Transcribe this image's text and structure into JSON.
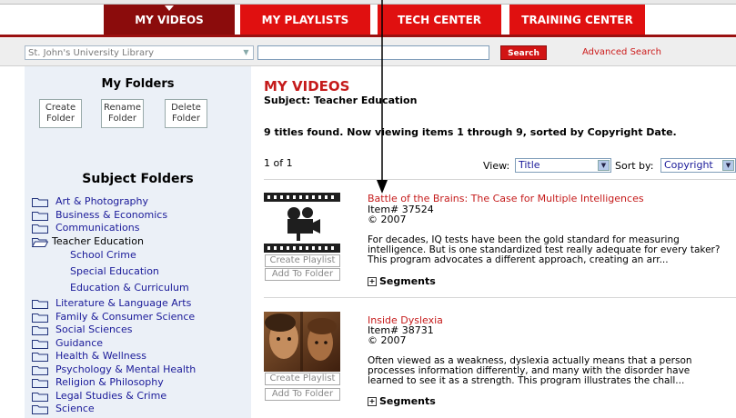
{
  "nav": {
    "tabs": [
      {
        "label": "MY VIDEOS"
      },
      {
        "label": "MY PLAYLISTS"
      },
      {
        "label": "TECH CENTER"
      },
      {
        "label": "TRAINING CENTER"
      }
    ]
  },
  "search": {
    "library_value": "St. John's University Library",
    "query_value": "",
    "button_label": "Search",
    "advanced_label": "Advanced Search"
  },
  "sidebar": {
    "my_folders_title": "My Folders",
    "folder_buttons": [
      {
        "line1": "Create",
        "line2": "Folder"
      },
      {
        "line1": "Rename",
        "line2": "Folder"
      },
      {
        "line1": "Delete",
        "line2": "Folder"
      }
    ],
    "subject_folders_title": "Subject Folders",
    "folders": [
      "Art & Photography",
      "Business & Economics",
      "Communications",
      "Teacher Education",
      "Literature & Language Arts",
      "Family & Consumer Science",
      "Social Sciences",
      "Guidance",
      "Health & Wellness",
      "Psychology & Mental Health",
      "Religion & Philosophy",
      "Legal Studies & Crime",
      "Science"
    ],
    "subfolders": [
      "School Crime",
      "Special Education",
      "Education & Curriculum"
    ]
  },
  "main": {
    "title": "MY VIDEOS",
    "subject": "Subject: Teacher Education",
    "found": "9 titles found. Now viewing items 1 through 9, sorted by Copyright Date.",
    "page": "1 of 1",
    "view_label": "View:",
    "view_value": "Title",
    "sort_label": "Sort by:",
    "sort_value": "Copyright",
    "videos": [
      {
        "title": "Battle of the Brains: The Case for Multiple Intelligences",
        "item": "Item# 37524",
        "year": "© 2007",
        "desc1": "For decades, IQ tests have been the gold standard for measuring",
        "desc2": "intelligence. But is one standardized test really adequate for every taker?",
        "desc3": "This program advocates a different approach, creating an arr...",
        "segments": "Segments",
        "btn_playlist": "Create Playlist",
        "btn_folder": "Add To Folder"
      },
      {
        "title": "Inside Dyslexia",
        "item": "Item# 38731",
        "year": "© 2007",
        "desc1": "Often viewed as a weakness, dyslexia actually means that a person",
        "desc2": "processes information differently, and many with the disorder have",
        "desc3": "learned to see it as a strength. This program illustrates the chall...",
        "segments": "Segments",
        "btn_playlist": "Create Playlist",
        "btn_folder": "Add To Folder"
      }
    ]
  }
}
